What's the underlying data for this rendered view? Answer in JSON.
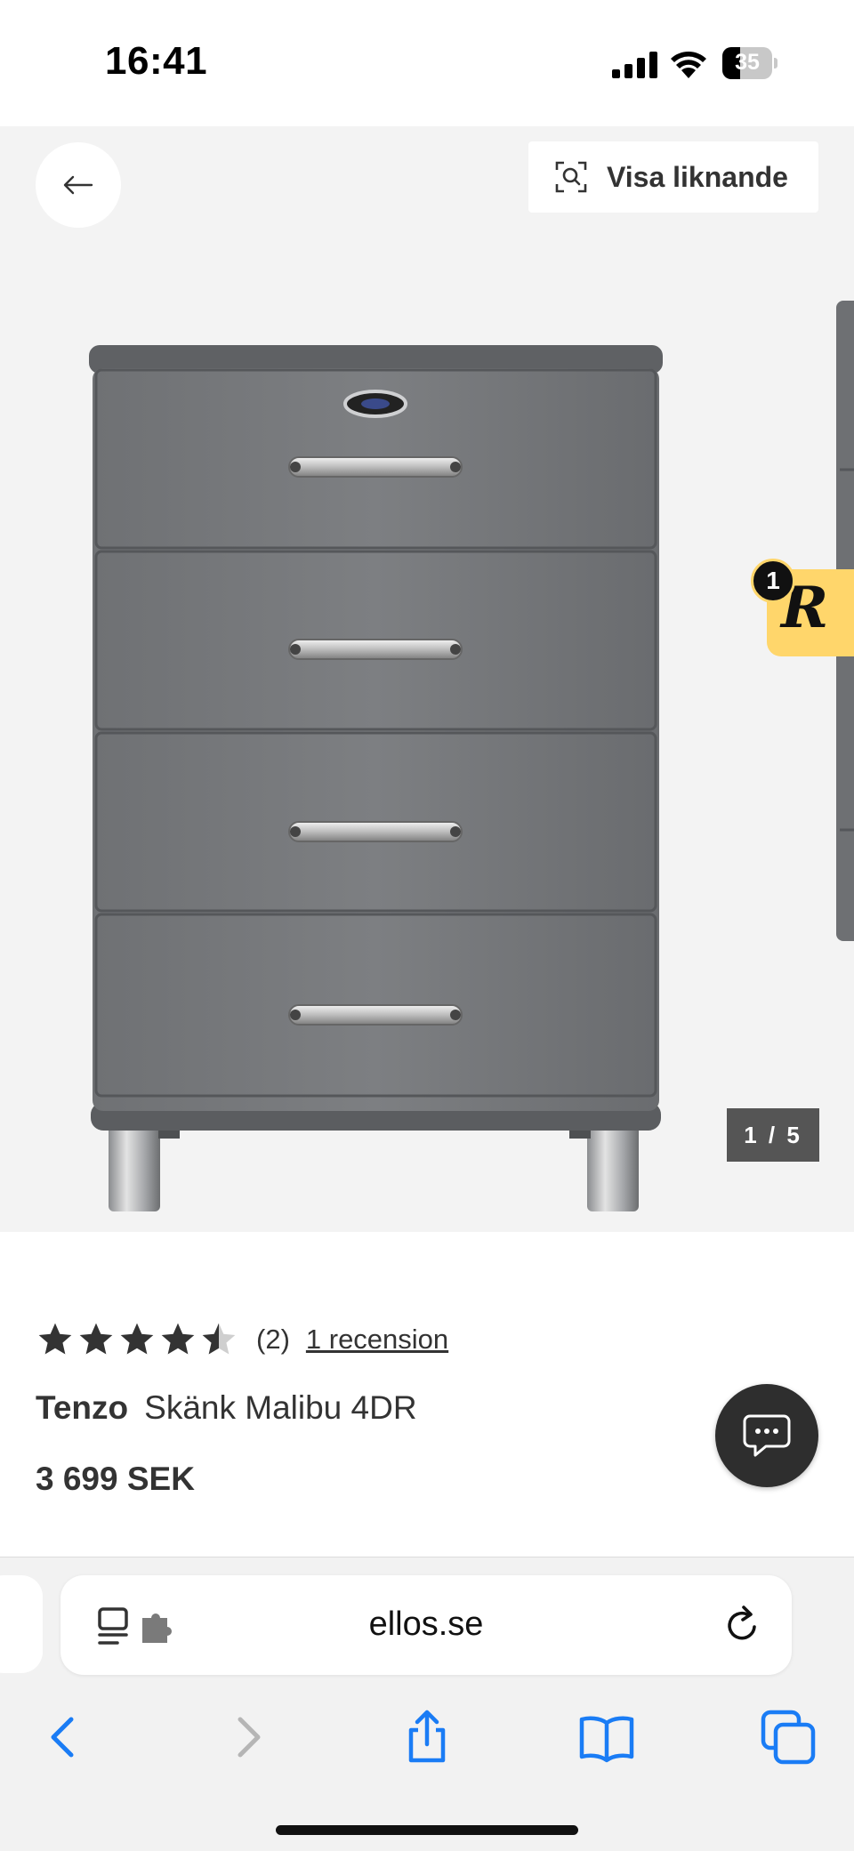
{
  "status_bar": {
    "time": "16:41",
    "battery": "35",
    "battery_level": 0.35
  },
  "gallery": {
    "similar_label": "Visa liknande",
    "image_counter": "1 / 5",
    "rewards_letter": "R",
    "rewards_badge": "1"
  },
  "product": {
    "rating": 4.5,
    "rating_count": "(2)",
    "review_link": "1 recension",
    "brand": "Tenzo",
    "name": "Skänk Malibu 4DR",
    "price": "3 699 SEK"
  },
  "browser": {
    "url": "ellos.se"
  },
  "icons": [
    "arrow-left-icon",
    "visual-search-icon",
    "chat-icon",
    "reader-icon",
    "extension-icon",
    "reload-icon",
    "back-icon",
    "forward-icon",
    "share-icon",
    "bookmarks-icon",
    "tabs-icon"
  ],
  "colors": {
    "accent": "#1a7cf5",
    "rewards": "#ffd66b",
    "chat": "#2e2e2e",
    "gallery_bg": "#f3f3f3"
  }
}
